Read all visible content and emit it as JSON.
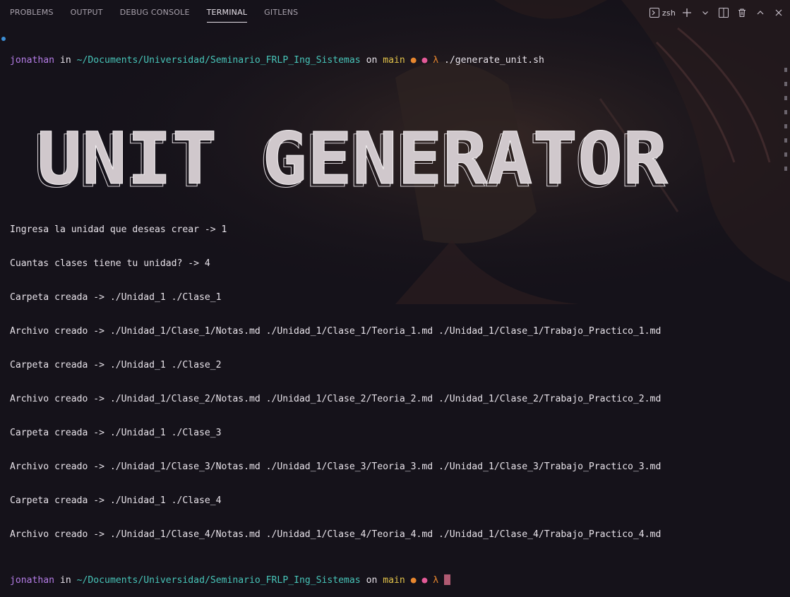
{
  "panel": {
    "tabs": [
      "PROBLEMS",
      "OUTPUT",
      "DEBUG CONSOLE",
      "TERMINAL",
      "GITLENS"
    ],
    "active_tab": "TERMINAL",
    "shell_name": "zsh"
  },
  "prompt": {
    "user": "jonathan",
    "in_word": "in",
    "path": "~/Documents/Universidad/Seminario_FRLP_Ing_Sistemas",
    "on_word": "on",
    "branch": "main",
    "lambda": "λ",
    "command": "./generate_unit.sh"
  },
  "banner_text": "UNIT GENERATOR",
  "output_lines": [
    "Ingresa la unidad que deseas crear -> 1",
    "Cuantas clases tiene tu unidad? -> 4",
    "Carpeta creada -> ./Unidad_1 ./Clase_1",
    "Archivo creado -> ./Unidad_1/Clase_1/Notas.md ./Unidad_1/Clase_1/Teoria_1.md ./Unidad_1/Clase_1/Trabajo_Practico_1.md",
    "Carpeta creada -> ./Unidad_1 ./Clase_2",
    "Archivo creado -> ./Unidad_1/Clase_2/Notas.md ./Unidad_1/Clase_2/Teoria_2.md ./Unidad_1/Clase_2/Trabajo_Practico_2.md",
    "Carpeta creada -> ./Unidad_1 ./Clase_3",
    "Archivo creado -> ./Unidad_1/Clase_3/Notas.md ./Unidad_1/Clase_3/Teoria_3.md ./Unidad_1/Clase_3/Trabajo_Practico_3.md",
    "Carpeta creada -> ./Unidad_1 ./Clase_4",
    "Archivo creado -> ./Unidad_1/Clase_4/Notas.md ./Unidad_1/Clase_4/Teoria_4.md ./Unidad_1/Clase_4/Trabajo_Practico_4.md"
  ],
  "colors": {
    "background": "#15121a",
    "user": "#b47ce6",
    "path": "#47c4b8",
    "branch": "#e0c14a",
    "dirty_dot": "#e8872e",
    "staged_dot": "#e45a98",
    "cursor": "#b05a72"
  },
  "icons": [
    "terminal-icon",
    "plus-icon",
    "chevron-down-icon",
    "split-icon",
    "trash-icon",
    "chevron-up-icon",
    "close-icon"
  ]
}
